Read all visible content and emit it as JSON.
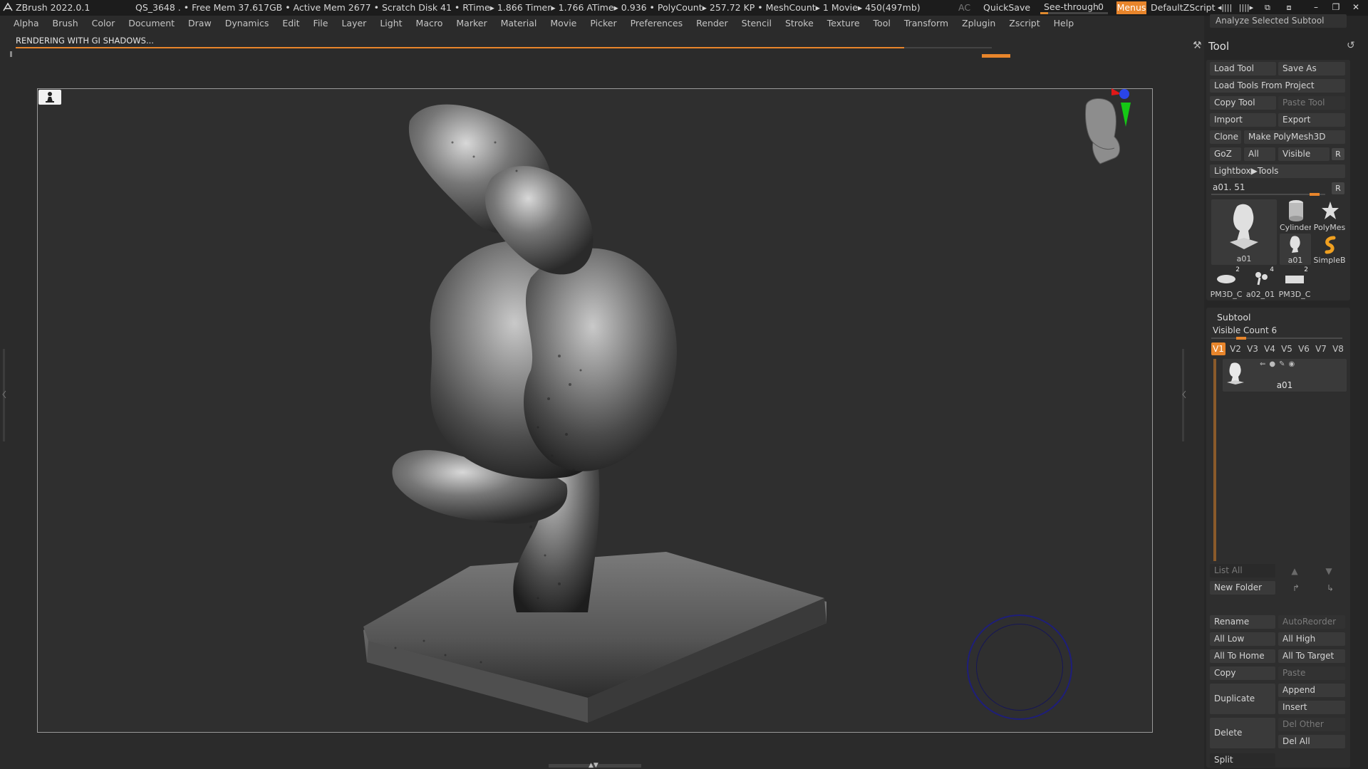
{
  "titlebar": {
    "app_title": "ZBrush 2022.0.1",
    "status": "QS_3648   . • Free Mem 37.617GB • Active Mem 2677 • Scratch Disk 41 •  RTime▸ 1.866 Timer▸ 1.766 ATime▸ 0.936 • PolyCount▸ 257.72 KP  • MeshCount▸ 1  Movie▸ 450(497mb)",
    "ac_label": "AC",
    "quicksave_label": "QuickSave",
    "seethrough_label": "See-through",
    "seethrough_value": "0",
    "seethrough_level": 0.12,
    "menus_label": "Menus",
    "script_label": "DefaultZScript",
    "accent_color": "#e8852b"
  },
  "menubar": [
    "Alpha",
    "Brush",
    "Color",
    "Document",
    "Draw",
    "Dynamics",
    "Edit",
    "File",
    "Layer",
    "Light",
    "Macro",
    "Marker",
    "Material",
    "Movie",
    "Picker",
    "Preferences",
    "Render",
    "Stencil",
    "Stroke",
    "Texture",
    "Tool",
    "Transform",
    "Zplugin",
    "Zscript",
    "Help"
  ],
  "render": {
    "status_text": "RENDERING WITH GI SHADOWS...",
    "progress": 0.91
  },
  "tool_panel": {
    "analyze_label": "Analyze Selected Subtool",
    "title": "Tool",
    "load_tool": "Load Tool",
    "save_as": "Save As",
    "load_from_project": "Load Tools From Project",
    "copy_tool": "Copy Tool",
    "paste_tool": "Paste Tool",
    "import": "Import",
    "export": "Export",
    "clone": "Clone",
    "make_polymesh": "Make PolyMesh3D",
    "goz": "GoZ",
    "all": "All",
    "visible": "Visible",
    "r": "R",
    "lightbox_tools": "Lightbox▶Tools",
    "current_tool": "a01. 51",
    "current_tool_level": 0.95,
    "thumbnails": [
      {
        "label": "a01",
        "icon": "sculpt-thumbnail-icon"
      },
      {
        "label": "Cylinder",
        "icon": "cylinder-icon"
      },
      {
        "label": "PolyMes",
        "icon": "star-icon"
      },
      {
        "label": "a01",
        "icon": "sculpt-thumbnail-icon"
      },
      {
        "label": "SimpleB",
        "icon": "simplebrush-icon"
      },
      {
        "label": "PM3D_C",
        "badge": "2",
        "icon": "disc-icon"
      },
      {
        "label": "a02_01",
        "badge": "4",
        "icon": "branch-icon"
      },
      {
        "label": "PM3D_C",
        "badge": "2",
        "icon": "box-icon"
      }
    ]
  },
  "subtool": {
    "title": "Subtool",
    "visible_count_label": "Visible Count 6",
    "visible_count_level": 0.19,
    "tabs": [
      "V1",
      "V2",
      "V3",
      "V4",
      "V5",
      "V6",
      "V7",
      "V8"
    ],
    "active_tab": "V1",
    "row_label": "a01",
    "list_all": "List All",
    "new_folder": "New Folder",
    "rename": "Rename",
    "auto_reorder": "AutoReorder",
    "all_low": "All Low",
    "all_high": "All High",
    "all_to_home": "All To Home",
    "all_to_target": "All To Target",
    "copy": "Copy",
    "paste": "Paste",
    "duplicate": "Duplicate",
    "append": "Append",
    "insert": "Insert",
    "delete": "Delete",
    "del_other": "Del Other",
    "del_all": "Del All",
    "split": "Split"
  }
}
